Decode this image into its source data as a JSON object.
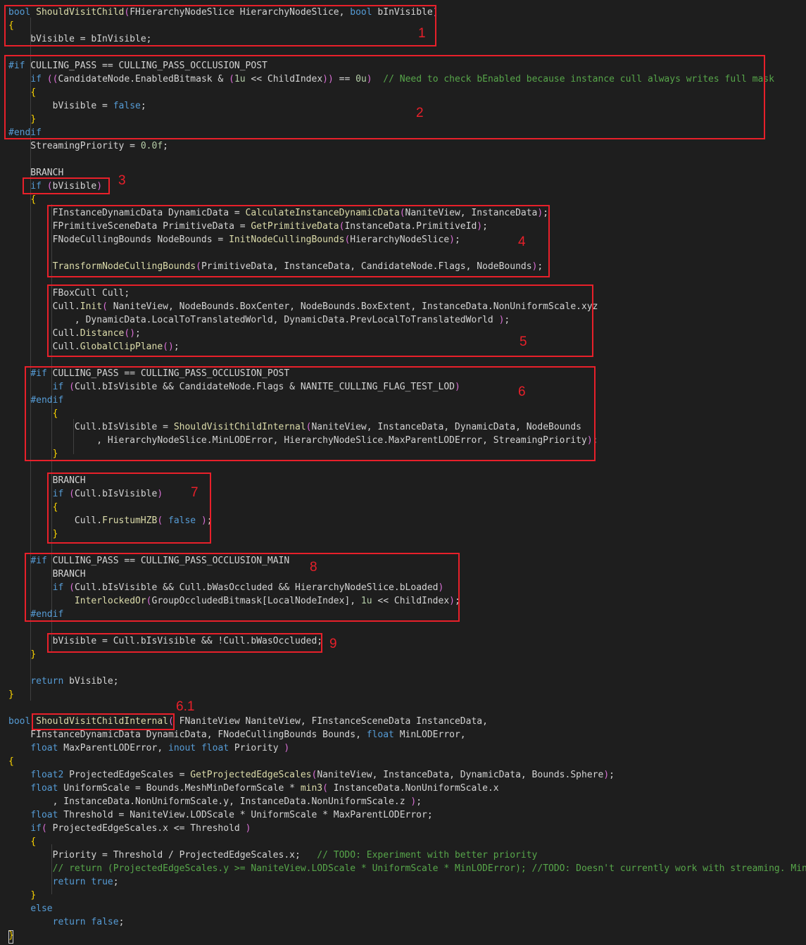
{
  "editor": {
    "lines": [
      "bool ShouldVisitChild(FHierarchyNodeSlice HierarchyNodeSlice, bool bInVisible)",
      "{",
      "    bVisible = bInVisible;",
      "",
      "#if CULLING_PASS == CULLING_PASS_OCCLUSION_POST",
      "    if ((CandidateNode.EnabledBitmask & (1u << ChildIndex)) == 0u)  // Need to check bEnabled because instance cull always writes full mask",
      "    {",
      "        bVisible = false;",
      "    }",
      "#endif",
      "    StreamingPriority = 0.0f;",
      "",
      "    BRANCH",
      "    if (bVisible)",
      "    {",
      "        FInstanceDynamicData DynamicData = CalculateInstanceDynamicData(NaniteView, InstanceData);",
      "        FPrimitiveSceneData PrimitiveData = GetPrimitiveData(InstanceData.PrimitiveId);",
      "        FNodeCullingBounds NodeBounds = InitNodeCullingBounds(HierarchyNodeSlice);",
      "",
      "        TransformNodeCullingBounds(PrimitiveData, InstanceData, CandidateNode.Flags, NodeBounds);",
      "",
      "        FBoxCull Cull;",
      "        Cull.Init( NaniteView, NodeBounds.BoxCenter, NodeBounds.BoxExtent, InstanceData.NonUniformScale.xyz",
      "            , DynamicData.LocalToTranslatedWorld, DynamicData.PrevLocalToTranslatedWorld );",
      "        Cull.Distance();",
      "        Cull.GlobalClipPlane();",
      "",
      "    #if CULLING_PASS == CULLING_PASS_OCCLUSION_POST",
      "        if (Cull.bIsVisible && CandidateNode.Flags & NANITE_CULLING_FLAG_TEST_LOD)",
      "    #endif",
      "        {",
      "            Cull.bIsVisible = ShouldVisitChildInternal(NaniteView, InstanceData, DynamicData, NodeBounds",
      "                , HierarchyNodeSlice.MinLODError, HierarchyNodeSlice.MaxParentLODError, StreamingPriority);",
      "        }",
      "",
      "        BRANCH",
      "        if (Cull.bIsVisible)",
      "        {",
      "            Cull.FrustumHZB( false );",
      "        }",
      "",
      "    #if CULLING_PASS == CULLING_PASS_OCCLUSION_MAIN",
      "        BRANCH",
      "        if (Cull.bIsVisible && Cull.bWasOccluded && HierarchyNodeSlice.bLoaded)",
      "            InterlockedOr(GroupOccludedBitmask[LocalNodeIndex], 1u << ChildIndex);",
      "    #endif",
      "",
      "        bVisible = Cull.bIsVisible && !Cull.bWasOccluded;",
      "    }",
      "",
      "    return bVisible;",
      "}",
      "",
      "bool ShouldVisitChildInternal( FNaniteView NaniteView, FInstanceSceneData InstanceData,",
      "    FInstanceDynamicData DynamicData, FNodeCullingBounds Bounds, float MinLODError,",
      "    float MaxParentLODError, inout float Priority )",
      "{",
      "    float2 ProjectedEdgeScales = GetProjectedEdgeScales(NaniteView, InstanceData, DynamicData, Bounds.Sphere);",
      "    float UniformScale = Bounds.MeshMinDeformScale * min3( InstanceData.NonUniformScale.x",
      "        , InstanceData.NonUniformScale.y, InstanceData.NonUniformScale.z );",
      "    float Threshold = NaniteView.LODScale * UniformScale * MaxParentLODError;",
      "    if( ProjectedEdgeScales.x <= Threshold )",
      "    {",
      "        Priority = Threshold / ProjectedEdgeScales.x;   // TODO: Experiment with better priority",
      "        // return (ProjectedEdgeScales.y >= NaniteView.LODScale * UniformScale * MinLODError); //TODO: Doesn't currently work with streaming. MinLODError",
      "        return true;",
      "    }",
      "    else",
      "        return false;",
      "}"
    ]
  },
  "annotations": [
    {
      "label": "1"
    },
    {
      "label": "2"
    },
    {
      "label": "3"
    },
    {
      "label": "4"
    },
    {
      "label": "5"
    },
    {
      "label": "6"
    },
    {
      "label": "7"
    },
    {
      "label": "8"
    },
    {
      "label": "9"
    },
    {
      "label": "6.1"
    }
  ],
  "colors": {
    "background": "#1e1e1e",
    "keyword": "#569cd6",
    "function": "#dcdcaa",
    "comment": "#57a64a",
    "number": "#b5cea8",
    "annotation": "#e8202a"
  }
}
